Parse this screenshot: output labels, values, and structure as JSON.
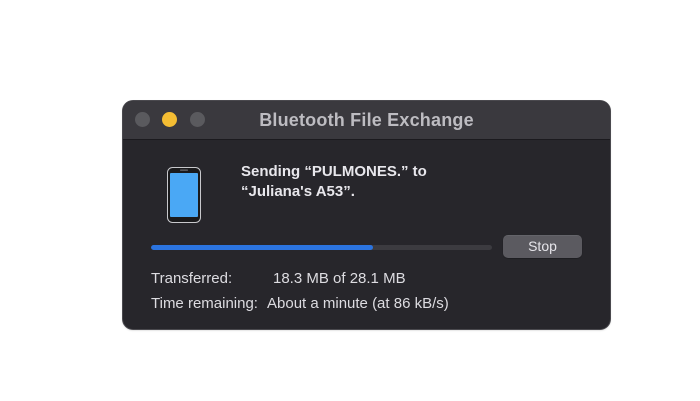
{
  "window": {
    "title": "Bluetooth File Exchange"
  },
  "message": {
    "line1": "Sending “PULMONES.” to",
    "line2": "“Juliana's A53”."
  },
  "progress": {
    "fraction": 0.65,
    "color": "#2b74e0"
  },
  "stop_button": {
    "label": "Stop"
  },
  "transferred": {
    "label": "Transferred:",
    "value": "18.3 MB of 28.1 MB"
  },
  "time_remaining": {
    "label": "Time remaining:",
    "value": "About a minute (at 86 kB/s)"
  },
  "icons": {
    "device": "phone-icon"
  }
}
